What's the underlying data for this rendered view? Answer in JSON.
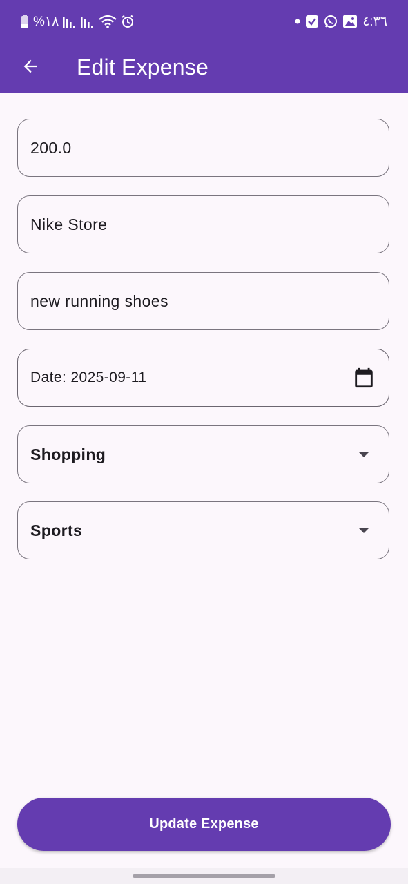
{
  "status_bar": {
    "battery_percent": "%١٨",
    "time": "٤:٣٦",
    "icons_left": [
      "battery-icon",
      "signal-icon",
      "signal-icon",
      "wifi-icon",
      "alarm-icon"
    ],
    "icons_right": [
      "dot-icon",
      "check-box-icon",
      "whatsapp-icon",
      "gallery-icon"
    ]
  },
  "app_bar": {
    "title": "Edit Expense",
    "back_icon": "arrow-back-icon"
  },
  "form": {
    "amount": "200.0",
    "merchant": "Nike Store",
    "note": "new running shoes",
    "date_label": "Date: 2025-09-11",
    "date_icon": "calendar-icon",
    "category": "Shopping",
    "subcategory": "Sports",
    "dropdown_icon": "arrow-drop-down-icon"
  },
  "actions": {
    "update_label": "Update Expense"
  },
  "colors": {
    "primary": "#643cb0",
    "background": "#fcf7fc",
    "outline": "#7a757f",
    "text": "#1d1b20"
  }
}
